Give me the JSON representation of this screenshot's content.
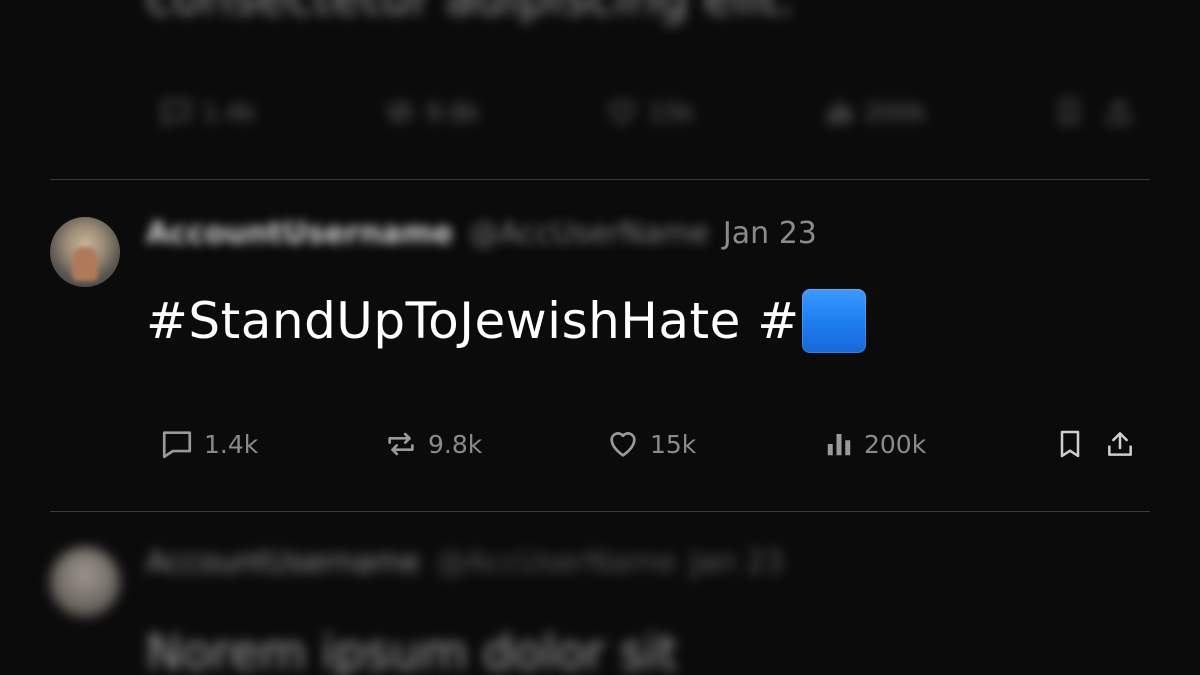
{
  "previous_post": {
    "text": "consectetur adipiscing elit.",
    "actions": {
      "replies": "1.4k",
      "reposts": "9.8k",
      "likes": "15k",
      "views": "200k"
    }
  },
  "post": {
    "display_name": "AccountUsername",
    "handle": "@AccUserName",
    "date": "Jan 23",
    "text": "#StandUpToJewishHate #",
    "emoji": "blue-square",
    "actions": {
      "replies": "1.4k",
      "reposts": "9.8k",
      "likes": "15k",
      "views": "200k"
    }
  },
  "next_post": {
    "display_name": "AccountUsername",
    "handle": "@AccUserName",
    "date": "Jan 23",
    "text": "Norem ipsum dolor sit"
  },
  "colors": {
    "background": "#0b0b0b",
    "divider": "#3a3a3a",
    "muted_text": "#8b8b8b",
    "primary_text": "#ffffff",
    "emoji_blue": "#1f7ff0"
  },
  "icons": [
    "reply-icon",
    "repost-icon",
    "like-icon",
    "views-icon",
    "bookmark-icon",
    "share-icon"
  ]
}
